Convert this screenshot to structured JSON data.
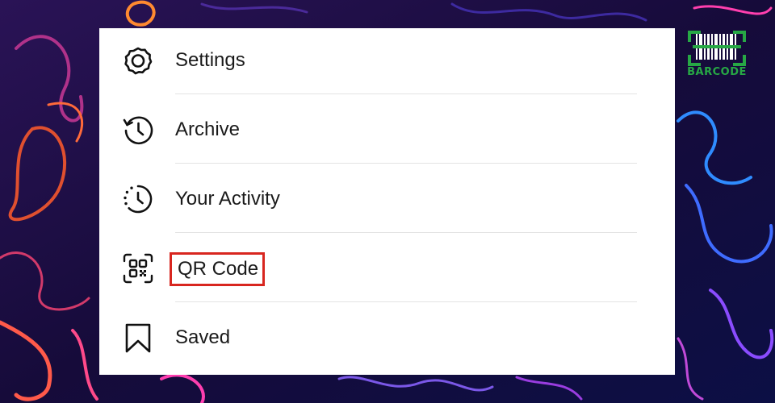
{
  "menu": {
    "items": [
      {
        "label": "Settings",
        "icon": "settings-gear-icon"
      },
      {
        "label": "Archive",
        "icon": "archive-history-icon"
      },
      {
        "label": "Your Activity",
        "icon": "activity-clock-icon"
      },
      {
        "label": "QR Code",
        "icon": "qr-code-icon",
        "highlighted": true
      },
      {
        "label": "Saved",
        "icon": "bookmark-icon"
      }
    ]
  },
  "brand": {
    "text": "BARCODE",
    "icon": "barcode-scan-icon",
    "color": "#27a845"
  },
  "colors": {
    "highlight_border": "#d8261f",
    "panel_background": "#ffffff",
    "page_background": "#1a0f3e"
  }
}
